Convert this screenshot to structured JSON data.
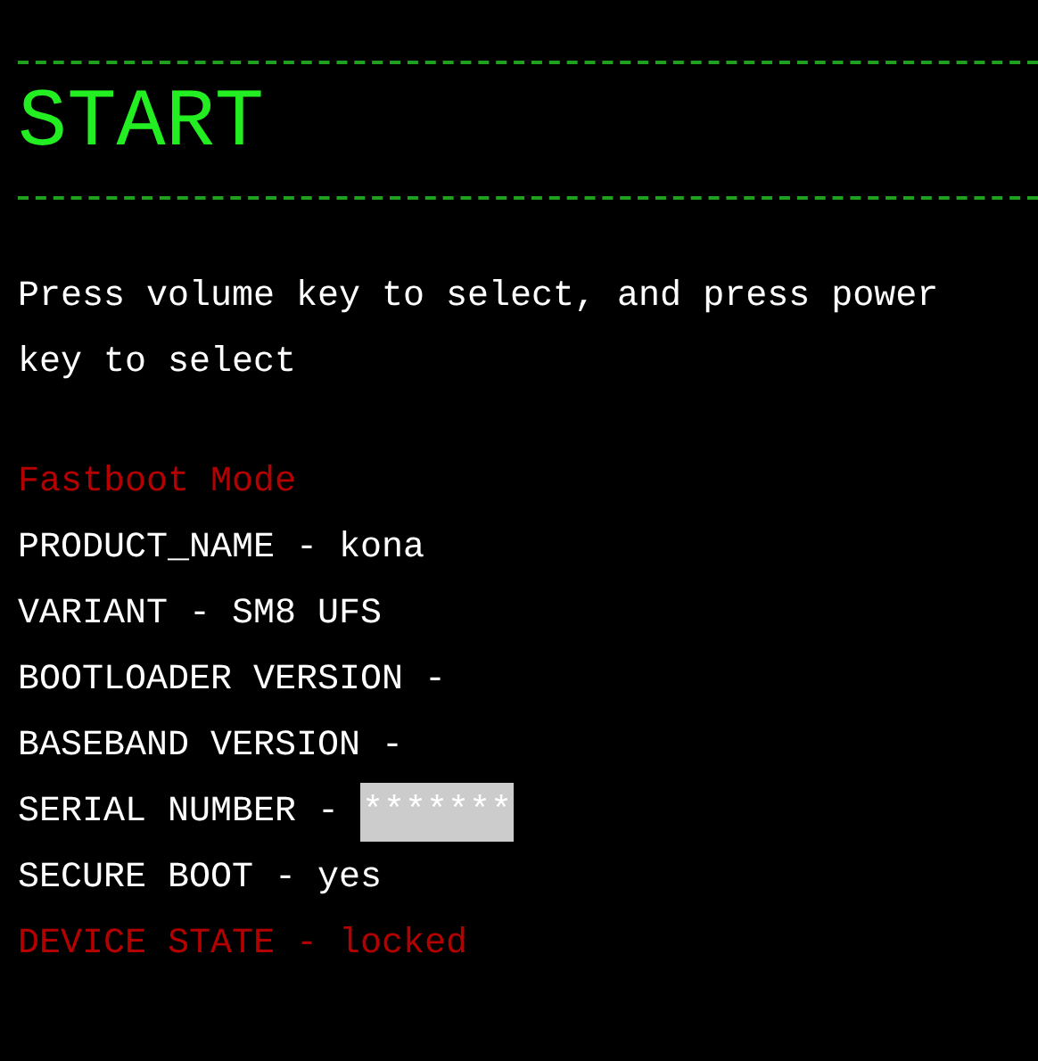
{
  "title": "START",
  "instruction": "Press volume key to select, and press power key to select",
  "lines": [
    {
      "kind": "plain",
      "text": "Fastboot Mode",
      "color": "#b40000"
    },
    {
      "kind": "plain",
      "text": "PRODUCT_NAME - kona",
      "color": "#ffffff"
    },
    {
      "kind": "plain",
      "text": "VARIANT - SM8 UFS",
      "color": "#ffffff"
    },
    {
      "kind": "plain",
      "text": "BOOTLOADER VERSION -",
      "color": "#ffffff"
    },
    {
      "kind": "plain",
      "text": "BASEBAND VERSION -",
      "color": "#ffffff"
    },
    {
      "kind": "masked",
      "text": "SERIAL NUMBER -",
      "value": "*******",
      "color": "#ffffff"
    },
    {
      "kind": "plain",
      "text": "SECURE BOOT - yes",
      "color": "#ffffff"
    },
    {
      "kind": "plain",
      "text": "DEVICE STATE - locked",
      "color": "#b40000"
    }
  ]
}
